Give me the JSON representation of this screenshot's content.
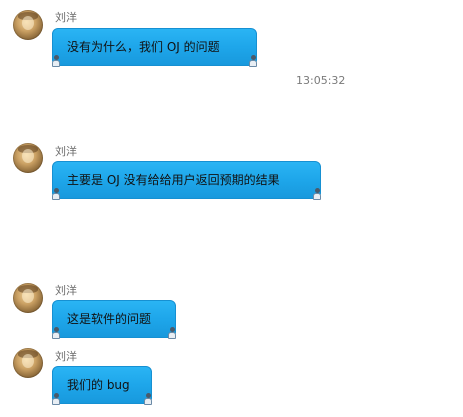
{
  "messages": [
    {
      "sender": "刘洋",
      "text": "没有为什么，我们 OJ 的问题"
    },
    {
      "sender": "刘洋",
      "text": "主要是 OJ 没有给给用户返回预期的结果"
    },
    {
      "sender": "刘洋",
      "text": "这是软件的问题"
    },
    {
      "sender": "刘洋",
      "text": "我们的 bug"
    }
  ],
  "timestamp": "13:05:32",
  "colors": {
    "bubble": "#1ea6ea",
    "bubble_border": "#1690d2",
    "name_text": "#6a6a6a",
    "timestamp_text": "#7a7a7a"
  },
  "icons": {
    "avatar": "user-avatar",
    "bubble_decoration": "chat-figure-icon"
  }
}
